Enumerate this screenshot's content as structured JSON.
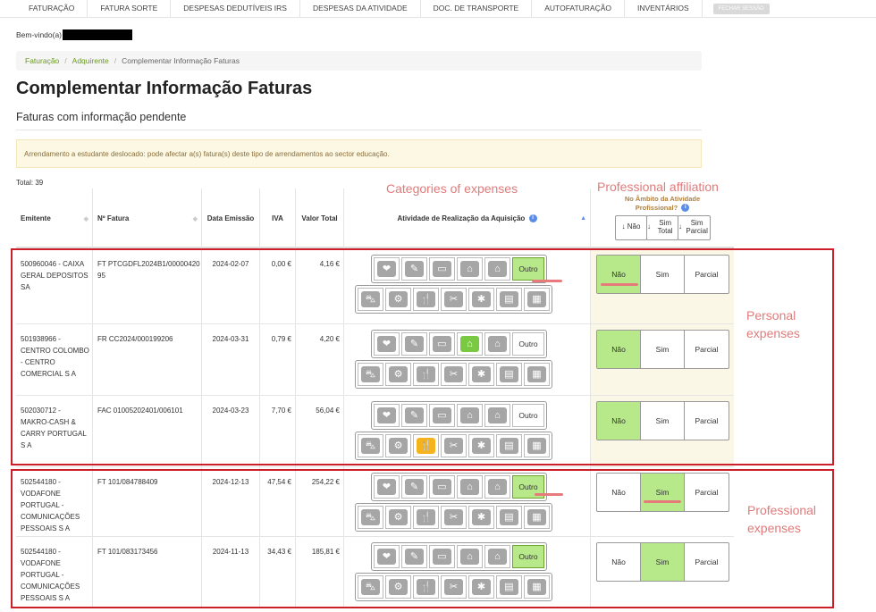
{
  "nav": {
    "items": [
      "FATURAÇÃO",
      "FATURA SORTE",
      "DESPESAS DEDUTÍVEIS IRS",
      "DESPESAS DA ATIVIDADE",
      "DOC. DE TRANSPORTE",
      "AUTOFATURAÇÃO",
      "INVENTÁRIOS"
    ],
    "logout_label": "FECHAR SESSÃO"
  },
  "welcome": "Bem-vindo(a)",
  "breadcrumb": [
    "Faturação",
    "Adquirente",
    "Complementar Informação Faturas"
  ],
  "title": "Complementar Informação Faturas",
  "subtitle": "Faturas com informação pendente",
  "alert": "Arrendamento a estudante deslocado: pode afectar a(s) fatura(s) deste tipo de arrendamentos ao sector educação.",
  "total": "Total: 39",
  "annotations": {
    "categories": "Categories of expenses",
    "professional": "Professional affiliation",
    "personal_expenses": "Personal expenses",
    "professional_expenses": "Professional expenses"
  },
  "table": {
    "headers": {
      "emitente": "Emitente",
      "n_fatura": "Nº Fatura",
      "data": "Data Emissão",
      "iva": "IVA",
      "valor": "Valor Total",
      "atividade": "Atividade de Realização da Aquisição",
      "ambito": "No Âmbito da Atividade Profissional?"
    },
    "filters": [
      "Não",
      "Sim Total",
      "Sim Parcial"
    ],
    "other_label": "Outro",
    "prof_options": [
      "Não",
      "Sim",
      "Parcial"
    ],
    "rows": [
      {
        "emitente": "500960046 - CAIXA GERAL DEPOSITOS SA",
        "fatura": "FT PTCGDFL2024B1/0000042095",
        "data": "2024-02-07",
        "iva": "0,00 €",
        "valor": "4,16 €",
        "selected_category": "outro",
        "prof": "Não"
      },
      {
        "emitente": "501938966 - CENTRO COLOMBO - CENTRO COMERCIAL S A",
        "fatura": "FR CC2024/000199206",
        "data": "2024-03-31",
        "iva": "0,79 €",
        "valor": "4,20 €",
        "selected_category": "housing",
        "prof": "Não"
      },
      {
        "emitente": "502030712 - MAKRO-CASH & CARRY PORTUGAL S A",
        "fatura": "FAC 01005202401/006101",
        "data": "2024-03-23",
        "iva": "7,70 €",
        "valor": "56,04 €",
        "selected_category": "restaurant",
        "prof": "Não"
      },
      {
        "emitente": "502544180 - VODAFONE PORTUGAL - COMUNICAÇÕES PESSOAIS S A",
        "fatura": "FT 101/084788409",
        "data": "2024-12-13",
        "iva": "47,54 €",
        "valor": "254,22 €",
        "selected_category": "outro",
        "prof": "Sim"
      },
      {
        "emitente": "502544180 - VODAFONE PORTUGAL - COMUNICAÇÕES PESSOAIS S A",
        "fatura": "FT 101/083173456",
        "data": "2024-11-13",
        "iva": "34,43 €",
        "valor": "185,81 €",
        "selected_category": "outro",
        "prof": "Sim"
      }
    ]
  },
  "category_icons_row1": [
    "heart-icon",
    "education-icon",
    "book-icon",
    "house-icon",
    "property-icon"
  ],
  "category_icons_row2": [
    "car-repair-icon",
    "motorcycle-repair-icon",
    "restaurant-icon",
    "hairdresser-icon",
    "veterinary-icon",
    "public-transport-icon",
    "newspaper-icon"
  ],
  "colors": {
    "selected_green": "#b7e88a",
    "selected_icon_green": "#7ac943",
    "selected_icon_yellow": "#f5b41e",
    "highlight_red": "#cc1f2a",
    "link_green": "#6a9a1f"
  }
}
